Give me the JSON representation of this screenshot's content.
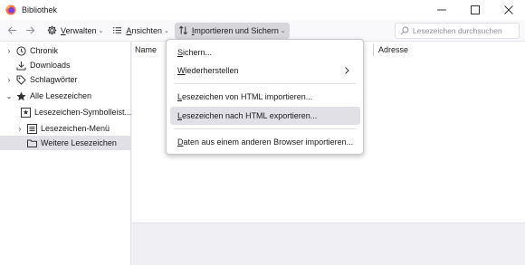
{
  "window": {
    "title": "Bibliothek",
    "minimize_icon": "minimize-icon",
    "maximize_icon": "maximize-icon",
    "close_icon": "close-icon"
  },
  "toolbar": {
    "back_icon": "arrow-left-icon",
    "forward_icon": "arrow-right-icon",
    "organize": {
      "icon": "gear-icon",
      "accel": "V",
      "rest": "erwalten"
    },
    "views": {
      "icon": "list-icon",
      "accel": "A",
      "rest": "nsichten"
    },
    "import": {
      "icon": "sort-arrows-icon",
      "accel": "I",
      "rest": "mportieren und Sichern"
    },
    "search_placeholder": "Lesezeichen durchsuchen"
  },
  "sidebar": {
    "items": [
      {
        "label": "Chronik",
        "icon": "clock-icon",
        "twisty": "›"
      },
      {
        "label": "Downloads",
        "icon": "download-icon",
        "twisty": ""
      },
      {
        "label": "Schlagwörter",
        "icon": "tag-icon",
        "twisty": "›"
      },
      {
        "label": "Alle Lesezeichen",
        "icon": "star-icon",
        "twisty": "⌄"
      },
      {
        "label": "Lesezeichen-Symbolleist...",
        "icon": "bookmark-toolbar-icon",
        "twisty": ""
      },
      {
        "label": "Lesezeichen-Menü",
        "icon": "bookmark-menu-icon",
        "twisty": "›"
      },
      {
        "label": "Weitere Lesezeichen",
        "icon": "folder-icon",
        "twisty": ""
      }
    ]
  },
  "columns": {
    "name": "Name",
    "address": "Adresse"
  },
  "menu": {
    "items": [
      {
        "accel": "S",
        "rest": "ichern..."
      },
      {
        "accel": "W",
        "rest": "iederherstellen"
      },
      {
        "accel": "L",
        "rest": "esezeichen von HTML importieren..."
      },
      {
        "accel": "L",
        "rest": "esezeichen nach HTML exportieren..."
      },
      {
        "accel": "D",
        "rest": "aten aus einem anderen Browser importieren..."
      }
    ]
  }
}
